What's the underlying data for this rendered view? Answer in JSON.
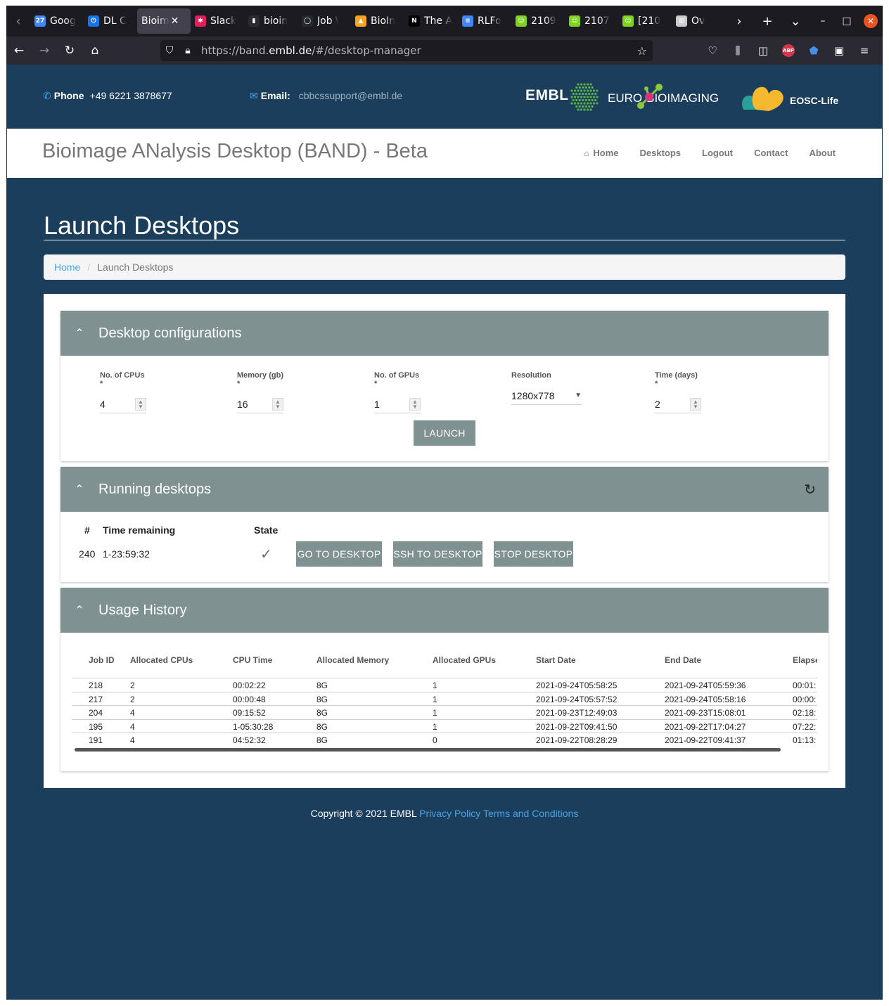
{
  "browser": {
    "tabs": [
      {
        "label": "Goog",
        "icon": "calendar-icon",
        "color": "#4285f4"
      },
      {
        "label": "DL C",
        "icon": "power-icon",
        "color": "#1a73e8"
      },
      {
        "label": "Bioim",
        "icon": "",
        "color": "#42414d"
      },
      {
        "label": "Slack",
        "icon": "slack-icon",
        "color": "#e01e5a"
      },
      {
        "label": "bioin",
        "icon": "terminal-icon",
        "color": "#2b2a33"
      },
      {
        "label": "Job \\",
        "icon": "github-icon",
        "color": "#24292e"
      },
      {
        "label": "BioIn",
        "icon": "bioimage-icon",
        "color": "#f6a623"
      },
      {
        "label": "The A",
        "icon": "notion-icon",
        "color": "#000000"
      },
      {
        "label": "RLFo",
        "icon": "docs-icon",
        "color": "#4285f4"
      },
      {
        "label": "2109",
        "icon": "smiley-icon",
        "color": "#7ed321"
      },
      {
        "label": "2107",
        "icon": "smiley-icon",
        "color": "#7ed321"
      },
      {
        "label": "[210",
        "icon": "smiley-icon",
        "color": "#7ed321"
      },
      {
        "label": "Ov",
        "icon": "book-icon",
        "color": "#cccccc"
      }
    ],
    "url_prefix": "https://band.",
    "url_domain": "embl.de",
    "url_path": "/#/desktop-manager"
  },
  "contact": {
    "phone_label": "Phone",
    "phone_value": "+49 6221 3878677",
    "email_label": "Email:",
    "email_value": "cbbcssupport@embl.de"
  },
  "logos": {
    "embl": "EMBL",
    "euro": "EURO",
    "bioimaging": "BIOIMAGING",
    "eosc": "EOSC-Life"
  },
  "header": {
    "brand": "Bioimage ANalysis Desktop (BAND) - Beta",
    "nav": [
      "Home",
      "Desktops",
      "Logout",
      "Contact",
      "About"
    ]
  },
  "page": {
    "title": "Launch Desktops",
    "breadcrumb_home": "Home",
    "breadcrumb_current": "Launch Desktops"
  },
  "config": {
    "title": "Desktop configurations",
    "cpus_label": "No. of CPUs *",
    "cpus_value": "4",
    "memory_label": "Memory (gb) *",
    "memory_value": "16",
    "gpus_label": "No. of GPUs *",
    "gpus_value": "1",
    "resolution_label": "Resolution",
    "resolution_value": "1280x778",
    "time_label": "Time (days) *",
    "time_value": "2",
    "launch_label": "LAUNCH"
  },
  "running": {
    "title": "Running desktops",
    "col_id": "#",
    "col_time": "Time remaining",
    "col_state": "State",
    "row": {
      "id": "240",
      "time": "1-23:59:32",
      "state": "check-icon"
    },
    "go_label": "GO TO DESKTOP",
    "ssh_label": "SSH TO DESKTOP",
    "stop_label": "STOP DESKTOP"
  },
  "history": {
    "title": "Usage History",
    "columns": [
      "Job ID",
      "Allocated CPUs",
      "CPU Time",
      "Allocated Memory",
      "Allocated GPUs",
      "Start Date",
      "End Date",
      "Elapse"
    ],
    "rows": [
      [
        "218",
        "2",
        "00:02:22",
        "8G",
        "1",
        "2021-09-24T05:58:25",
        "2021-09-24T05:59:36",
        "00:01:"
      ],
      [
        "217",
        "2",
        "00:00:48",
        "8G",
        "1",
        "2021-09-24T05:57:52",
        "2021-09-24T05:58:16",
        "00:00:"
      ],
      [
        "204",
        "4",
        "09:15:52",
        "8G",
        "1",
        "2021-09-23T12:49:03",
        "2021-09-23T15:08:01",
        "02:18:"
      ],
      [
        "195",
        "4",
        "1-05:30:28",
        "8G",
        "1",
        "2021-09-22T09:41:50",
        "2021-09-22T17:04:27",
        "07:22:"
      ],
      [
        "191",
        "4",
        "04:52:32",
        "8G",
        "0",
        "2021-09-22T08:28:29",
        "2021-09-22T09:41:37",
        "01:13:"
      ]
    ]
  },
  "footer": {
    "copyright": "Copyright © 2021 EMBL",
    "privacy": "Privacy Policy",
    "terms": "Terms and Conditions"
  }
}
